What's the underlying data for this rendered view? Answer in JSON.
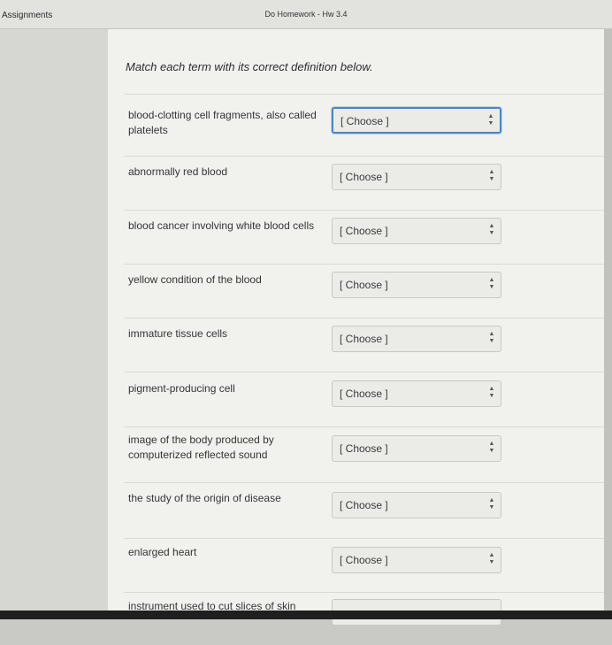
{
  "header": {
    "breadcrumb": "Assignments",
    "title": "Do Homework - Hw 3.4"
  },
  "quiz": {
    "instruction": "Match each term with its correct definition below.",
    "rows": [
      {
        "term": "blood-clotting cell fragments, also called platelets",
        "selected": "[ Choose ]"
      },
      {
        "term": "abnormally red blood",
        "selected": "[ Choose ]"
      },
      {
        "term": "blood cancer involving white blood cells",
        "selected": "[ Choose ]"
      },
      {
        "term": "yellow condition of the blood",
        "selected": "[ Choose ]"
      },
      {
        "term": "immature tissue cells",
        "selected": "[ Choose ]"
      },
      {
        "term": "pigment-producing cell",
        "selected": "[ Choose ]"
      },
      {
        "term": "image of the body produced by computerized reflected sound",
        "selected": "[ Choose ]"
      },
      {
        "term": "the study of the origin of disease",
        "selected": "[ Choose ]"
      },
      {
        "term": "enlarged heart",
        "selected": "[ Choose ]"
      },
      {
        "term": "instrument used to cut slices of skin",
        "selected": ""
      }
    ]
  },
  "icons": {
    "select_arrows": "up-down-arrows-icon"
  },
  "colors": {
    "focus_border": "#4a86c5",
    "content_bg": "#f1f1ee",
    "header_bg": "#e2e2df"
  }
}
